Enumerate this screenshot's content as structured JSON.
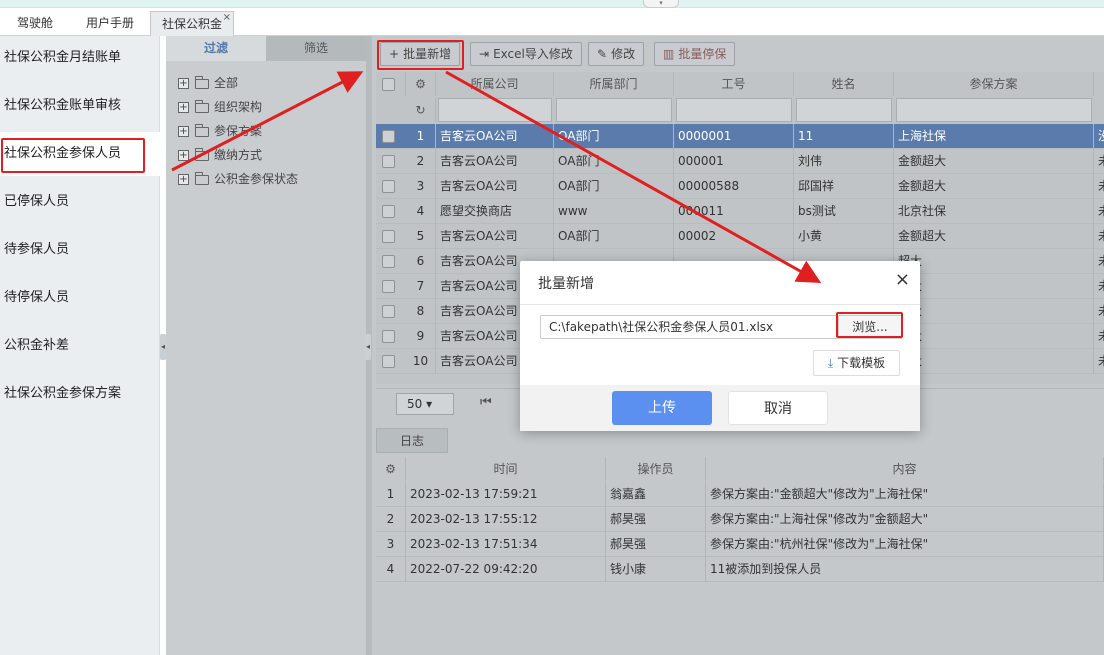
{
  "tabs": [
    {
      "label": "驾驶舱"
    },
    {
      "label": "用户手册"
    },
    {
      "label": "社保公积金",
      "close": "×"
    }
  ],
  "menu": {
    "items": [
      {
        "label": "社保公积金月结账单"
      },
      {
        "label": "社保公积金账单审核"
      },
      {
        "label": "社保公积金参保人员"
      },
      {
        "label": "已停保人员"
      },
      {
        "label": "待参保人员"
      },
      {
        "label": "待停保人员"
      },
      {
        "label": "公积金补差"
      },
      {
        "label": "社保公积金参保方案"
      }
    ]
  },
  "tree": {
    "tabs": [
      {
        "label": "过滤"
      },
      {
        "label": "筛选"
      }
    ],
    "items": [
      {
        "label": "全部"
      },
      {
        "label": "组织架构"
      },
      {
        "label": "参保方案"
      },
      {
        "label": "缴纳方式"
      },
      {
        "label": "公积金参保状态"
      }
    ]
  },
  "toolbar": {
    "batch_add": "批量新增",
    "excel_import": "Excel导入修改",
    "edit": "修改",
    "batch_stop": "批量停保"
  },
  "grid": {
    "headers": [
      "所属公司",
      "所属部门",
      "工号",
      "姓名",
      "参保方案"
    ],
    "rows": [
      {
        "no": "1",
        "company": "吉客云OA公司",
        "dept": "OA部门",
        "id": "0000001",
        "name": "11",
        "plan": "上海社保",
        "extra": "没"
      },
      {
        "no": "2",
        "company": "吉客云OA公司",
        "dept": "OA部门",
        "id": "000001",
        "name": "刘伟",
        "plan": "金额超大",
        "extra": "未"
      },
      {
        "no": "3",
        "company": "吉客云OA公司",
        "dept": "OA部门",
        "id": "00000588",
        "name": "邱国祥",
        "plan": "金额超大",
        "extra": "未"
      },
      {
        "no": "4",
        "company": "愿望交换商店",
        "dept": "www",
        "id": "000011",
        "name": "bs测试",
        "plan": "北京社保",
        "extra": "未"
      },
      {
        "no": "5",
        "company": "吉客云OA公司",
        "dept": "OA部门",
        "id": "00002",
        "name": "小黄",
        "plan": "金额超大",
        "extra": "未"
      },
      {
        "no": "6",
        "company": "吉客云OA公司",
        "dept": "",
        "id": "",
        "name": "",
        "plan": "超大",
        "extra": "未"
      },
      {
        "no": "7",
        "company": "吉客云OA公司",
        "dept": "",
        "id": "",
        "name": "",
        "plan": "超大",
        "extra": "未"
      },
      {
        "no": "8",
        "company": "吉客云OA公司",
        "dept": "",
        "id": "",
        "name": "",
        "plan": "超大",
        "extra": "未"
      },
      {
        "no": "9",
        "company": "吉客云OA公司",
        "dept": "",
        "id": "",
        "name": "",
        "plan": "超大",
        "extra": "未"
      },
      {
        "no": "10",
        "company": "吉客云OA公司",
        "dept": "",
        "id": "",
        "name": "",
        "plan": "超大",
        "extra": "未"
      }
    ]
  },
  "pager": {
    "size": "50"
  },
  "log": {
    "tab": "日志",
    "headers": [
      "时间",
      "操作员",
      "内容"
    ],
    "rows": [
      {
        "no": "1",
        "time": "2023-02-13 17:59:21",
        "op": "翁嘉鑫",
        "content": "参保方案由:\"金额超大\"修改为\"上海社保\""
      },
      {
        "no": "2",
        "time": "2023-02-13 17:55:12",
        "op": "郝昊强",
        "content": "参保方案由:\"上海社保\"修改为\"金额超大\""
      },
      {
        "no": "3",
        "time": "2023-02-13 17:51:34",
        "op": "郝昊强",
        "content": "参保方案由:\"杭州社保\"修改为\"上海社保\""
      },
      {
        "no": "4",
        "time": "2022-07-22 09:42:20",
        "op": "钱小康",
        "content": "11被添加到投保人员"
      }
    ]
  },
  "dialog": {
    "title": "批量新增",
    "close": "×",
    "file_path": "C:\\fakepath\\社保公积金参保人员01.xlsx",
    "browse": "浏览...",
    "download_template": "下载模板",
    "upload": "上传",
    "cancel": "取消"
  },
  "colors": {
    "accent": "#5b8ff0",
    "highlight": "#e02020",
    "selected_row": "#5a7bab"
  },
  "icons": [
    "plus-icon",
    "excel-icon",
    "edit-icon",
    "trash-icon",
    "gear-icon",
    "refresh-icon",
    "folder-icon",
    "download-icon",
    "first-page-icon"
  ]
}
